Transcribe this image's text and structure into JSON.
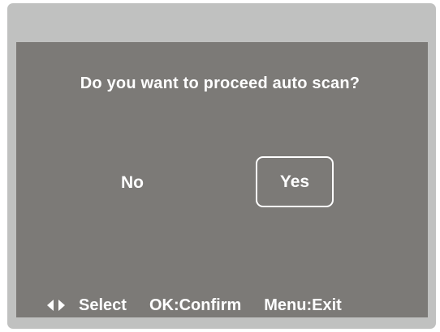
{
  "dialog": {
    "question": "Do you want to proceed auto scan?",
    "options": {
      "no": "No",
      "yes": "Yes"
    },
    "selected": "Yes"
  },
  "footer": {
    "nav_icon": "left-right-arrows-icon",
    "select_label": "Select",
    "confirm_label": "OK:Confirm",
    "exit_label": "Menu:Exit"
  },
  "colors": {
    "frame": "#c0c1c0",
    "panel": "#7c7a77",
    "text": "#ffffff"
  }
}
